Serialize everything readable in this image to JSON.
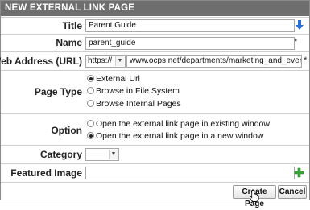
{
  "dialog": {
    "title": "NEW EXTERNAL LINK PAGE"
  },
  "title_field": {
    "label": "Title",
    "value": "Parent Guide",
    "required": "*"
  },
  "name_field": {
    "label": "Name",
    "value": "parent_guide",
    "required": "*"
  },
  "web_address_field": {
    "label": "Web Address (URL)",
    "protocol": "https://",
    "value": "www.ocps.net/departments/marketing_and_events/publ",
    "required": "*"
  },
  "page_type": {
    "label": "Page Type",
    "options": [
      "External Url",
      "Browse in File System",
      "Browse Internal Pages"
    ],
    "selected": "External Url"
  },
  "option": {
    "label": "Option",
    "options": [
      "Open the external link page in existing window",
      "Open the external link page in a new window"
    ],
    "selected": "Open the external link page in a new window"
  },
  "category": {
    "label": "Category",
    "value": ""
  },
  "featured_image": {
    "label": "Featured Image",
    "value": ""
  },
  "buttons": {
    "create": "Create Page",
    "cancel": "Cancel"
  },
  "colors": {
    "titlebar": "#6e6e6e",
    "arrow_blue": "#2a6fd6",
    "plus_green": "#3aa63a"
  }
}
